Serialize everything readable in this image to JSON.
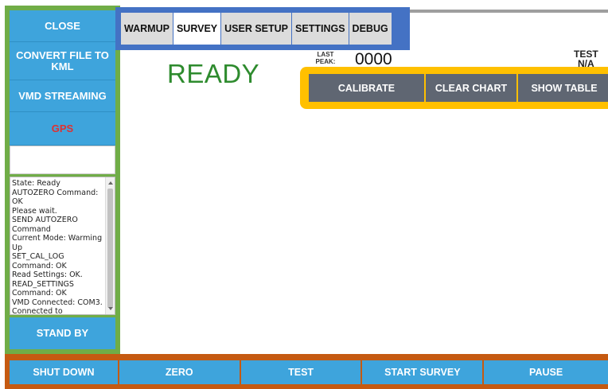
{
  "sidebar": {
    "close_label": "CLOSE",
    "convert_label": "CONVERT FILE TO KML",
    "vmd_label": "VMD STREAMING",
    "gps_label": "GPS",
    "log_text": "State: Ready\nAUTOZERO Command: OK\nPlease wait.\nSEND AUTOZERO Command\nCurrent Mode: Warming Up\nSET_CAL_LOG Command: OK\nRead Settings: OK.\nREAD_SETTINGS Command: OK\nVMD Connected: COM3.\nConnected to",
    "standby_label": "STAND BY"
  },
  "tabs": [
    {
      "label": "WARMUP",
      "active": false
    },
    {
      "label": "SURVEY",
      "active": true
    },
    {
      "label": "USER SETUP",
      "active": false
    },
    {
      "label": "SETTINGS",
      "active": false
    },
    {
      "label": "DEBUG",
      "active": false
    }
  ],
  "main": {
    "status": "READY",
    "last_peak_label": "LAST PEAK:",
    "last_peak_value": "0000",
    "test_label": "TEST",
    "test_value": "N/A"
  },
  "chart_actions": {
    "calibrate_label": "CALIBRATE",
    "clear_chart_label": "CLEAR CHART",
    "show_table_label": "SHOW TABLE"
  },
  "bottom": {
    "shutdown_label": "SHUT DOWN",
    "zero_label": "ZERO",
    "test_label": "TEST",
    "start_survey_label": "START SURVEY",
    "pause_label": "PAUSE"
  },
  "colors": {
    "sidebar_frame": "#70ad47",
    "tab_frame": "#4472c4",
    "actions_frame": "#ffc000",
    "bottom_frame": "#c55a11",
    "button_blue": "#3ea4dc",
    "button_gray": "#5f6672",
    "ready_green": "#2e8b2e",
    "gps_red": "#e03030"
  }
}
